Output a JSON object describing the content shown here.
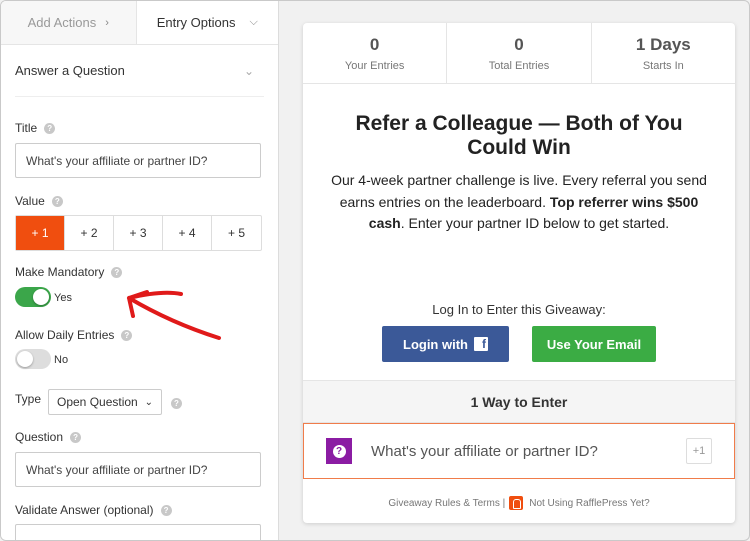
{
  "tabs": {
    "add_actions": "Add Actions",
    "entry_options": "Entry Options"
  },
  "section": {
    "title": "Answer a Question"
  },
  "form": {
    "title_label": "Title",
    "title_value": "What's your affiliate or partner ID?",
    "value_label": "Value",
    "value_options": [
      "+ 1",
      "+ 2",
      "+ 3",
      "+ 4",
      "+ 5"
    ],
    "value_selected": "+ 1",
    "mandatory_label": "Make Mandatory",
    "mandatory_state": "Yes",
    "daily_label": "Allow Daily Entries",
    "daily_state": "No",
    "type_label": "Type",
    "type_value": "Open Question",
    "question_label": "Question",
    "question_value": "What's your affiliate or partner ID?",
    "validate_label": "Validate Answer (optional)"
  },
  "stats": [
    {
      "value": "0",
      "label": "Your Entries"
    },
    {
      "value": "0",
      "label": "Total Entries"
    },
    {
      "value": "1 Days",
      "label": "Starts In"
    }
  ],
  "giveaway": {
    "headline": "Refer a Colleague — Both of You Could Win",
    "desc_pre": "Our 4-week partner challenge is live. Every referral you send earns entries on the leaderboard. ",
    "desc_bold": "Top referrer wins $500 cash",
    "desc_post": ". Enter your partner ID below to get started.",
    "login_prompt": "Log In to Enter this Giveaway:",
    "login_fb": "Login with",
    "login_email": "Use Your Email",
    "ways": "1 Way to Enter",
    "entry_text": "What's your affiliate or partner ID?",
    "entry_points": "+1",
    "footer_rules": "Giveaway Rules & Terms |",
    "footer_cta": "Not Using RafflePress Yet?"
  },
  "colors": {
    "accent": "#f04e0f",
    "toggle_on": "#3ba64a",
    "facebook": "#3b5998",
    "email_btn": "#3bac44",
    "question_icon": "#8b1ca3",
    "annotation_arrow": "#e01a1a"
  },
  "icons": [
    "chevron-right-icon",
    "chevron-down-icon",
    "help-icon",
    "facebook-icon",
    "question-icon",
    "rafflepress-icon",
    "annotation-arrow-icon"
  ]
}
